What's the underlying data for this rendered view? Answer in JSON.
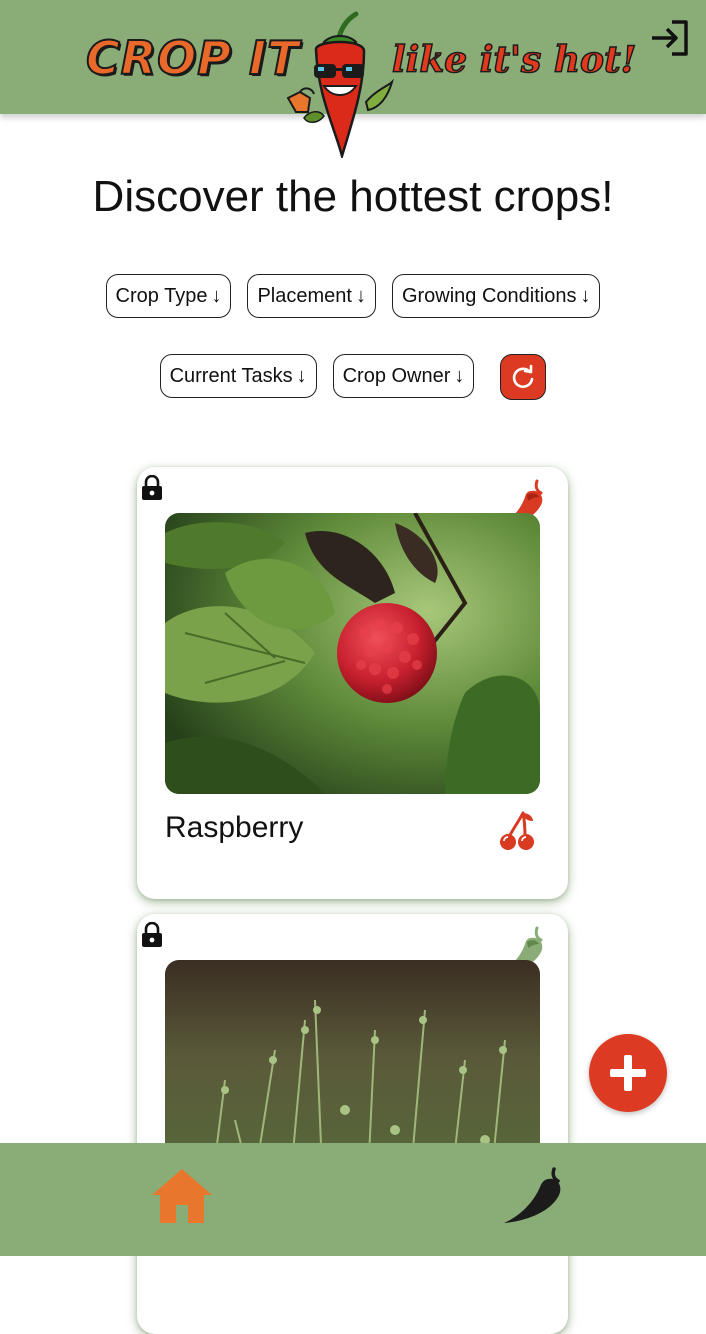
{
  "header": {
    "brand_left": "CROP IT",
    "brand_right": "like it's hot!",
    "mascot_icon": "chili-mascot-icon",
    "login_icon": "login-icon"
  },
  "page": {
    "title": "Discover the hottest crops!"
  },
  "filters": {
    "row1": [
      {
        "label": "Crop Type",
        "arrow": "↓"
      },
      {
        "label": "Placement",
        "arrow": "↓"
      },
      {
        "label": "Growing Conditions",
        "arrow": "↓"
      }
    ],
    "row2": [
      {
        "label": "Current Tasks",
        "arrow": "↓"
      },
      {
        "label": "Crop Owner",
        "arrow": "↓"
      }
    ],
    "reset_icon": "refresh-icon"
  },
  "cards": [
    {
      "name": "Raspberry",
      "lock_icon": "lock-icon",
      "badge_icon": "red-pepper-icon",
      "badge_color": "#d93a22",
      "type_icon": "cherry-icon"
    },
    {
      "name": "",
      "lock_icon": "lock-icon",
      "badge_icon": "green-pepper-icon",
      "badge_color": "#8aad78"
    }
  ],
  "fab": {
    "icon": "plus-icon"
  },
  "bottom_nav": {
    "home_icon": "home-icon",
    "crops_icon": "pepper-icon"
  },
  "colors": {
    "accent_green": "#8aad78",
    "accent_red": "#dc3a22",
    "home_orange": "#e8762c"
  }
}
